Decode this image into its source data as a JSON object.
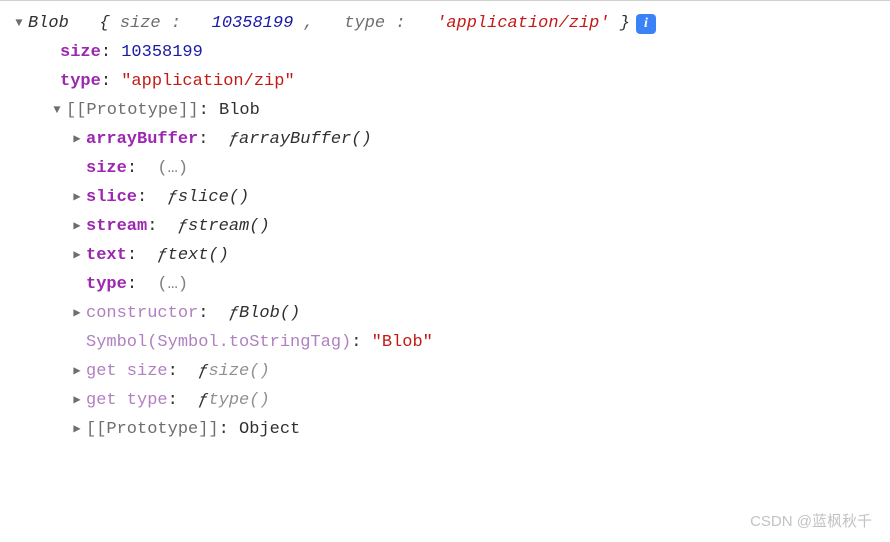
{
  "summary": {
    "class_name": "Blob",
    "open_brace": "{",
    "size_key": "size",
    "size_value": "10358199",
    "comma": ",",
    "type_key": "type",
    "type_value": "'application/zip'",
    "close_brace": "}",
    "info": "i"
  },
  "own": {
    "size_key": "size",
    "size_value": "10358199",
    "type_key": "type",
    "type_value": "\"application/zip\""
  },
  "proto": {
    "label": "[[Prototype]]",
    "value": "Blob",
    "items": [
      {
        "key": "arrayBuffer",
        "fn": "arrayBuffer()",
        "kind": "fn",
        "exp": true,
        "faded_fn": false
      },
      {
        "key": "size",
        "kind": "ellipsis",
        "exp": false
      },
      {
        "key": "slice",
        "fn": "slice()",
        "kind": "fn",
        "exp": true,
        "faded_fn": false
      },
      {
        "key": "stream",
        "fn": "stream()",
        "kind": "fn",
        "exp": true,
        "faded_fn": false
      },
      {
        "key": "text",
        "fn": "text()",
        "kind": "fn",
        "exp": true,
        "faded_fn": false
      },
      {
        "key": "type",
        "kind": "ellipsis",
        "exp": false
      },
      {
        "key": "constructor",
        "fn": "Blob()",
        "kind": "fn",
        "exp": true,
        "faded_key": true
      },
      {
        "key": "Symbol(Symbol.toStringTag)",
        "str": "\"Blob\"",
        "kind": "str",
        "exp": false,
        "faded_key": true
      },
      {
        "key": "get size",
        "fn": "size()",
        "kind": "fn",
        "exp": true,
        "faded_key": true,
        "faded_fn": true
      },
      {
        "key": "get type",
        "fn": "type()",
        "kind": "fn",
        "exp": true,
        "faded_key": true,
        "faded_fn": true
      }
    ],
    "inner_proto_label": "[[Prototype]]",
    "inner_proto_value": "Object"
  },
  "colon": ":",
  "f_glyph": "ƒ",
  "ellipsis": "(…)",
  "watermark": "CSDN @蓝枫秋千"
}
